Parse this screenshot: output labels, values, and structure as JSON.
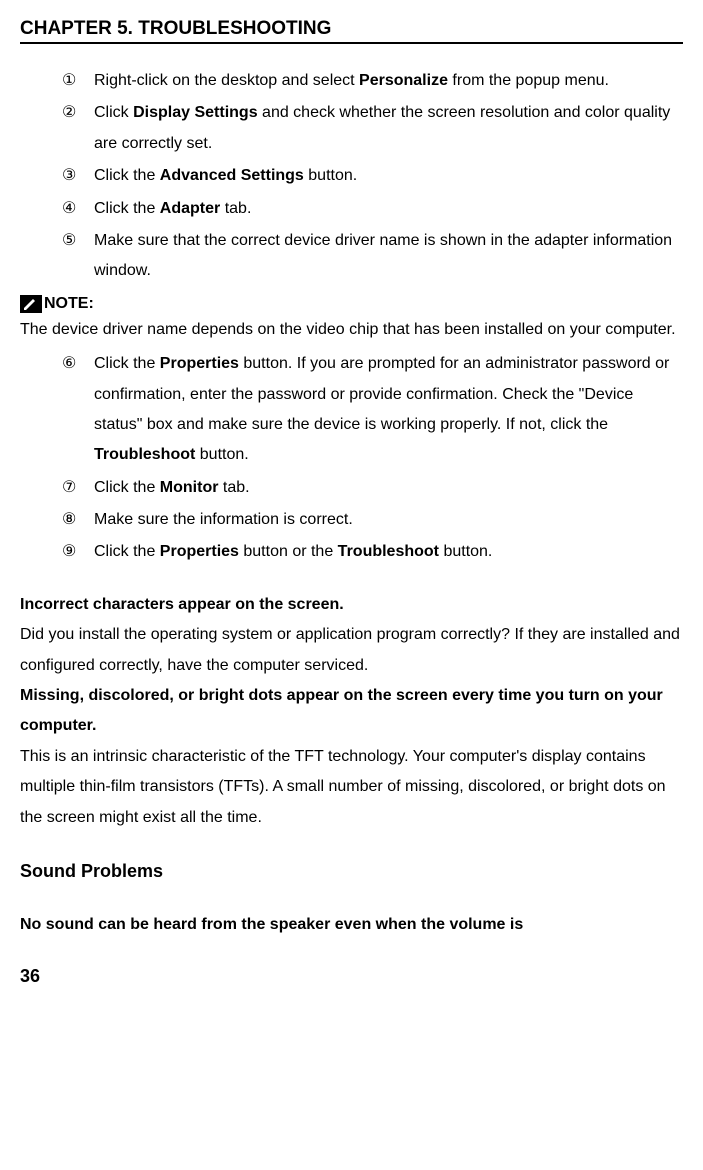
{
  "header": {
    "title": "CHAPTER 5. TROUBLESHOOTING"
  },
  "list1": {
    "items": [
      {
        "marker": "①",
        "pre": "Right-click on the desktop and select ",
        "bold": "Personalize",
        "post": " from the popup menu."
      },
      {
        "marker": "②",
        "pre": "Click ",
        "bold": "Display Settings",
        "post": " and check whether the screen resolution and color quality are correctly set."
      },
      {
        "marker": "③",
        "pre": "Click the ",
        "bold": "Advanced Settings",
        "post": " button."
      },
      {
        "marker": "④",
        "pre": "Click the ",
        "bold": "Adapter",
        "post": " tab."
      },
      {
        "marker": "⑤",
        "pre": "Make sure that the correct device driver name is shown in the adapter information window.",
        "bold": "",
        "post": ""
      }
    ]
  },
  "note": {
    "label": "NOTE:",
    "body": "The device driver name depends on the video chip that has been installed on your computer."
  },
  "list2": {
    "items": [
      {
        "marker": "⑥",
        "segments": [
          {
            "t": "Click the "
          },
          {
            "t": "Properties",
            "b": true
          },
          {
            "t": " button. If you are prompted for an administrator password or confirmation, enter the password or provide confirmation. Check the \"Device status\" box and make sure the device is working properly. If not, click the "
          },
          {
            "t": "Troubleshoot",
            "b": true
          },
          {
            "t": " button."
          }
        ]
      },
      {
        "marker": "⑦",
        "segments": [
          {
            "t": "Click the "
          },
          {
            "t": "Monitor",
            "b": true
          },
          {
            "t": " tab."
          }
        ]
      },
      {
        "marker": "⑧",
        "segments": [
          {
            "t": "Make sure the information is correct."
          }
        ]
      },
      {
        "marker": "⑨",
        "segments": [
          {
            "t": "Click the "
          },
          {
            "t": "Properties",
            "b": true
          },
          {
            "t": " button or the "
          },
          {
            "t": "Troubleshoot",
            "b": true
          },
          {
            "t": " button."
          }
        ]
      }
    ]
  },
  "issues": [
    {
      "heading": "Incorrect characters appear on the screen.",
      "body": "Did you install the operating system or application program correctly? If they are installed and configured correctly, have the computer serviced."
    },
    {
      "heading": "Missing, discolored, or bright dots appear on the screen every time you turn on your computer.",
      "body": "This is an intrinsic characteristic of the TFT technology. Your computer's display contains multiple thin-film transistors (TFTs). A small number of missing, discolored, or bright dots on the screen might exist all the time."
    }
  ],
  "section": {
    "title": "Sound Problems"
  },
  "trailing": {
    "heading": "No sound can be heard from the speaker even when the volume is"
  },
  "page": {
    "number": "36"
  }
}
